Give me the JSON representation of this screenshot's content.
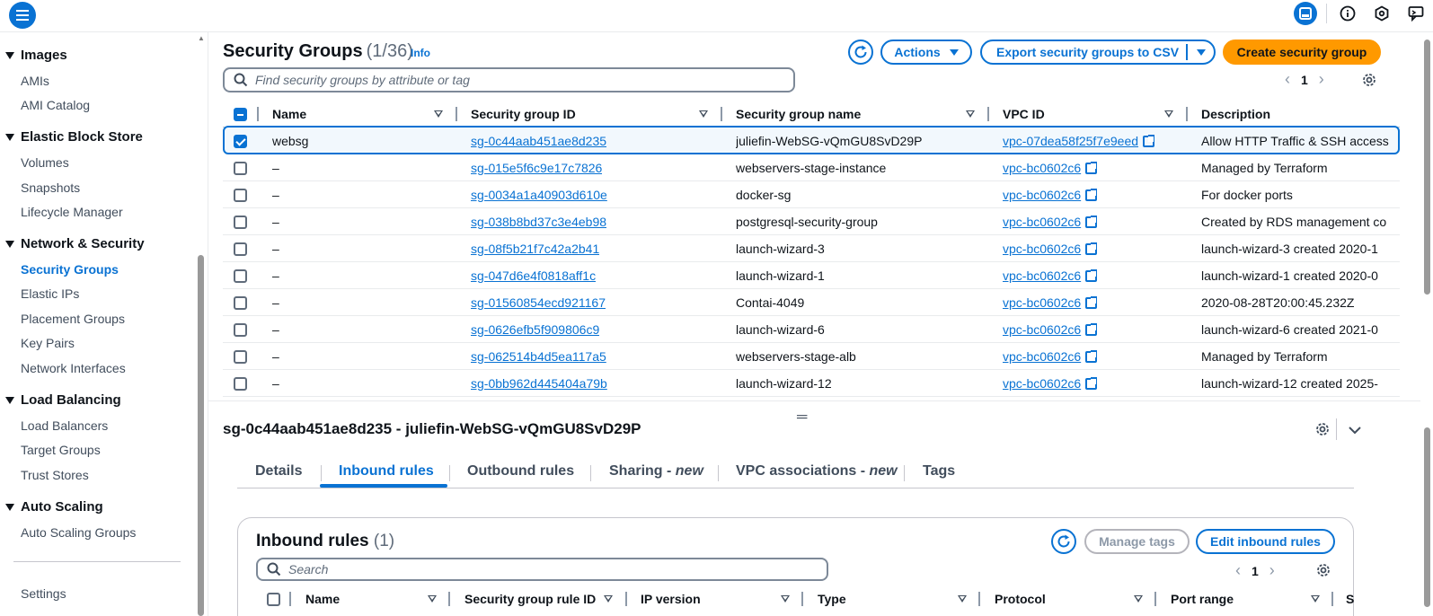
{
  "topbar": {
    "icons": [
      "menu-icon",
      "panel-icon",
      "info-icon",
      "settings-hex-icon",
      "feedback-icon"
    ]
  },
  "sidebar": {
    "sections": [
      {
        "label": "Images",
        "items": [
          "AMIs",
          "AMI Catalog"
        ]
      },
      {
        "label": "Elastic Block Store",
        "items": [
          "Volumes",
          "Snapshots",
          "Lifecycle Manager"
        ]
      },
      {
        "label": "Network & Security",
        "items": [
          "Security Groups",
          "Elastic IPs",
          "Placement Groups",
          "Key Pairs",
          "Network Interfaces"
        ]
      },
      {
        "label": "Load Balancing",
        "items": [
          "Load Balancers",
          "Target Groups",
          "Trust Stores"
        ]
      },
      {
        "label": "Auto Scaling",
        "items": [
          "Auto Scaling Groups"
        ]
      }
    ],
    "active_item": "Security Groups",
    "footer": "Settings"
  },
  "header": {
    "title": "Security Groups",
    "count": "(1/36)",
    "info": "Info",
    "actions_label": "Actions",
    "export_label": "Export security groups to CSV",
    "create_label": "Create security group"
  },
  "search": {
    "placeholder": "Find security groups by attribute or tag"
  },
  "pagination": {
    "page": "1"
  },
  "table": {
    "columns": [
      "Name",
      "Security group ID",
      "Security group name",
      "VPC ID",
      "Description"
    ],
    "rows": [
      {
        "selected": true,
        "name": "websg",
        "id": "sg-0c44aab451ae8d235",
        "group_name": "juliefin-WebSG-vQmGU8SvD29P",
        "vpc": "vpc-07dea58f25f7e9eed",
        "desc": "Allow HTTP Traffic & SSH access"
      },
      {
        "selected": false,
        "name": "–",
        "id": "sg-015e5f6c9e17c7826",
        "group_name": "webservers-stage-instance",
        "vpc": "vpc-bc0602c6",
        "desc": "Managed by Terraform"
      },
      {
        "selected": false,
        "name": "–",
        "id": "sg-0034a1a40903d610e",
        "group_name": "docker-sg",
        "vpc": "vpc-bc0602c6",
        "desc": "For docker ports"
      },
      {
        "selected": false,
        "name": "–",
        "id": "sg-038b8bd37c3e4eb98",
        "group_name": "postgresql-security-group",
        "vpc": "vpc-bc0602c6",
        "desc": "Created by RDS management co"
      },
      {
        "selected": false,
        "name": "–",
        "id": "sg-08f5b21f7c42a2b41",
        "group_name": "launch-wizard-3",
        "vpc": "vpc-bc0602c6",
        "desc": "launch-wizard-3 created 2020-1"
      },
      {
        "selected": false,
        "name": "–",
        "id": "sg-047d6e4f0818aff1c",
        "group_name": "launch-wizard-1",
        "vpc": "vpc-bc0602c6",
        "desc": "launch-wizard-1 created 2020-0"
      },
      {
        "selected": false,
        "name": "–",
        "id": "sg-01560854ecd921167",
        "group_name": "Contai-4049",
        "vpc": "vpc-bc0602c6",
        "desc": "2020-08-28T20:00:45.232Z"
      },
      {
        "selected": false,
        "name": "–",
        "id": "sg-0626efb5f909806c9",
        "group_name": "launch-wizard-6",
        "vpc": "vpc-bc0602c6",
        "desc": "launch-wizard-6 created 2021-0"
      },
      {
        "selected": false,
        "name": "–",
        "id": "sg-062514b4d5ea117a5",
        "group_name": "webservers-stage-alb",
        "vpc": "vpc-bc0602c6",
        "desc": "Managed by Terraform"
      },
      {
        "selected": false,
        "name": "–",
        "id": "sg-0bb962d445404a79b",
        "group_name": "launch-wizard-12",
        "vpc": "vpc-bc0602c6",
        "desc": "launch-wizard-12 created 2025-"
      }
    ]
  },
  "detail": {
    "title": "sg-0c44aab451ae8d235 - juliefin-WebSG-vQmGU8SvD29P",
    "tabs": [
      {
        "label": "Details",
        "suffix": ""
      },
      {
        "label": "Inbound rules",
        "suffix": ""
      },
      {
        "label": "Outbound rules",
        "suffix": ""
      },
      {
        "label": "Sharing - ",
        "suffix": "new"
      },
      {
        "label": "VPC associations - ",
        "suffix": "new"
      },
      {
        "label": "Tags",
        "suffix": ""
      }
    ],
    "active_tab": "Inbound rules"
  },
  "inbound": {
    "title": "Inbound rules",
    "count": "(1)",
    "manage_tags": "Manage tags",
    "edit": "Edit inbound rules",
    "search_placeholder": "Search",
    "page": "1",
    "columns": [
      "Name",
      "Security group rule ID",
      "IP version",
      "Type",
      "Protocol",
      "Port range",
      "S"
    ]
  },
  "colors": {
    "accent": "#0972d3",
    "primary_button": "#ff9900",
    "text": "#0f141a"
  }
}
